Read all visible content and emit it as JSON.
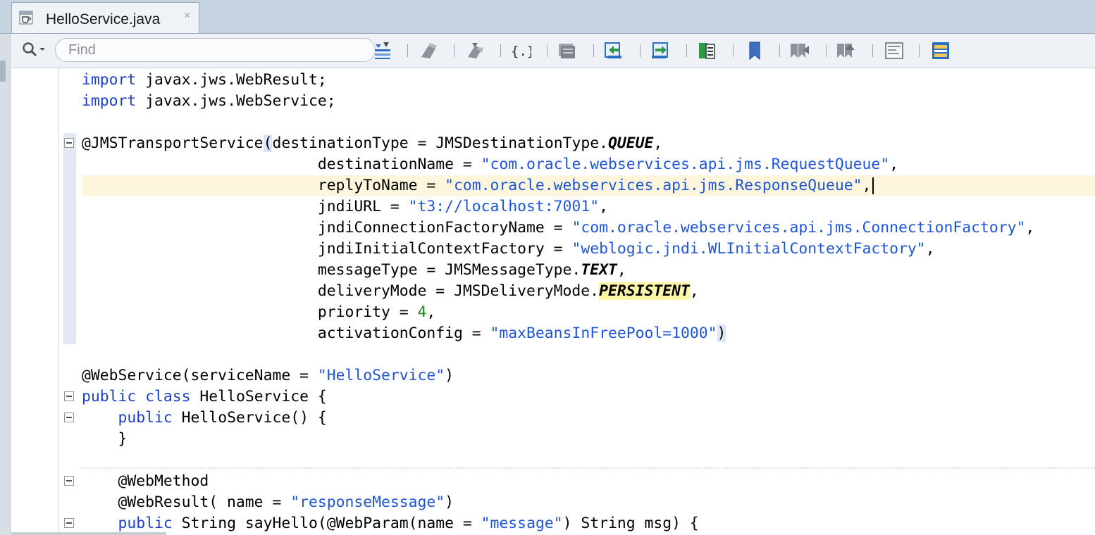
{
  "editor": {
    "tab": {
      "title": "HelloService.java",
      "close": "×",
      "icon": "java-file-icon"
    },
    "find": {
      "placeholder": "Find"
    },
    "toolbar_icons": [
      "toggle-highlight-icon",
      "previous-occurrence-icon",
      "next-occurrence-icon",
      "braces-icon",
      "toggle-comment-icon",
      "shift-left-icon",
      "shift-right-icon",
      "start-macro-icon",
      "toggle-bookmark-icon",
      "previous-bookmark-icon",
      "next-bookmark-icon",
      "stop-macro-icon",
      "diff-icon"
    ]
  },
  "code_lines": [
    {
      "seg": [
        {
          "c": "kw",
          "t": "import"
        },
        {
          "t": " javax.jws.WebResult;"
        }
      ]
    },
    {
      "seg": [
        {
          "c": "kw",
          "t": "import"
        },
        {
          "t": " javax.jws.WebService;"
        }
      ]
    },
    {
      "seg": []
    },
    {
      "seg": [
        {
          "t": "@JMSTransportService"
        },
        {
          "c": "paren-hl",
          "t": "("
        },
        {
          "t": "destinationType = JMSDestinationType."
        },
        {
          "c": "bi",
          "t": "QUEUE"
        },
        {
          "t": ","
        }
      ]
    },
    {
      "seg": [
        {
          "t": "                          destinationName = "
        },
        {
          "c": "str",
          "t": "\"com.oracle.webservices.api.jms.RequestQueue\""
        },
        {
          "t": ","
        }
      ]
    },
    {
      "seg": [
        {
          "t": "                          replyToName = "
        },
        {
          "c": "str",
          "t": "\"com.oracle.webservices.api.jms.ResponseQueue\""
        },
        {
          "t": ","
        }
      ],
      "caret": true,
      "highlight": true
    },
    {
      "seg": [
        {
          "t": "                          jndiURL = "
        },
        {
          "c": "str",
          "t": "\"t3://localhost:7001\""
        },
        {
          "t": ","
        }
      ]
    },
    {
      "seg": [
        {
          "t": "                          jndiConnectionFactoryName = "
        },
        {
          "c": "str",
          "t": "\"com.oracle.webservices.api.jms.ConnectionFactory\""
        },
        {
          "t": ","
        }
      ]
    },
    {
      "seg": [
        {
          "t": "                          jndiInitialContextFactory = "
        },
        {
          "c": "str",
          "t": "\"weblogic.jndi.WLInitialContextFactory\""
        },
        {
          "t": ","
        }
      ]
    },
    {
      "seg": [
        {
          "t": "                          messageType = JMSMessageType."
        },
        {
          "c": "bi",
          "t": "TEXT"
        },
        {
          "t": ","
        }
      ]
    },
    {
      "seg": [
        {
          "t": "                          deliveryMode = JMSDeliveryMode."
        },
        {
          "c": "bi mark-occ",
          "t": "PERSISTENT"
        },
        {
          "t": ","
        }
      ]
    },
    {
      "seg": [
        {
          "t": "                          priority = "
        },
        {
          "c": "num",
          "t": "4"
        },
        {
          "t": ","
        }
      ]
    },
    {
      "seg": [
        {
          "t": "                          activationConfig = "
        },
        {
          "c": "str",
          "t": "\"maxBeansInFreePool=1000\""
        },
        {
          "c": "paren-hl",
          "t": ")"
        }
      ]
    },
    {
      "seg": []
    },
    {
      "seg": [
        {
          "t": "@WebService(serviceName = "
        },
        {
          "c": "str",
          "t": "\"HelloService\""
        },
        {
          "t": ")"
        }
      ]
    },
    {
      "seg": [
        {
          "c": "kw",
          "t": "public class"
        },
        {
          "t": " HelloService {"
        }
      ]
    },
    {
      "seg": [
        {
          "t": "    "
        },
        {
          "c": "kw",
          "t": "public"
        },
        {
          "t": " HelloService() {"
        }
      ]
    },
    {
      "seg": [
        {
          "t": "    }"
        }
      ]
    },
    {
      "seg": []
    },
    {
      "seg": [
        {
          "t": "    @WebMethod"
        }
      ]
    },
    {
      "seg": [
        {
          "t": "    @WebResult( name = "
        },
        {
          "c": "str",
          "t": "\"responseMessage\""
        },
        {
          "t": ")"
        }
      ]
    },
    {
      "seg": [
        {
          "t": "    "
        },
        {
          "c": "kw",
          "t": "public"
        },
        {
          "t": " String sayHello(@WebParam(name = "
        },
        {
          "c": "str",
          "t": "\"message\""
        },
        {
          "t": ") String msg) {"
        }
      ]
    }
  ]
}
